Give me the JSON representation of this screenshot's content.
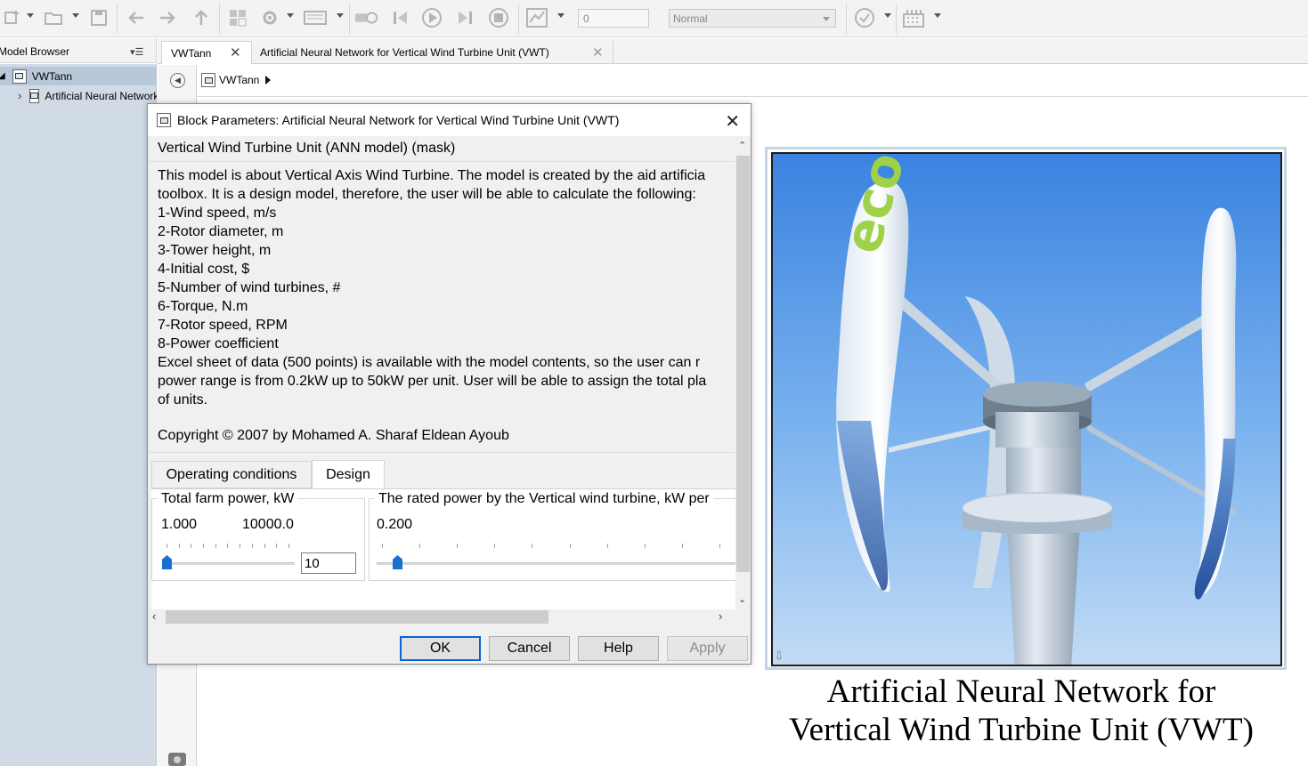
{
  "toolbar": {
    "stop_time_value": "0",
    "sim_mode": "Normal",
    "icons": [
      "new-model-icon",
      "open-icon",
      "save-icon",
      "back-icon",
      "forward-icon",
      "up-icon",
      "library-icon",
      "settings-icon",
      "explorer-icon",
      "record-icon",
      "step-back-icon",
      "run-icon",
      "step-forward-icon",
      "stop-icon",
      "scope-icon",
      "check-icon",
      "grid-icon"
    ]
  },
  "model_browser": {
    "title": "Model Browser",
    "menu_glyph": "▾☰",
    "items": [
      {
        "label": "VWTann"
      },
      {
        "label": "Artificial Neural Network for Vertical Wind Turbine Unit (VWT)"
      }
    ]
  },
  "tabs": [
    {
      "label": "VWTann",
      "close": "✕"
    },
    {
      "label": "Artificial Neural Network for  Vertical Wind Turbine Unit (VWT)",
      "close": "✕"
    }
  ],
  "breadcrumb": {
    "root": "VWTann"
  },
  "block": {
    "caption_line1": "Artificial Neural Network for",
    "caption_line2": "Vertical Wind Turbine Unit (VWT)",
    "image_text": "eco"
  },
  "dialog": {
    "title": "Block Parameters: Artificial Neural Network for  Vertical Wind Turbine Unit (VWT)",
    "mask_type": "Vertical Wind Turbine Unit (ANN model) (mask)",
    "description_lines": [
      "This model is about Vertical Axis Wind Turbine. The model is created by the aid artificia",
      "toolbox. It is a design model, therefore, the user will be able to calculate the following:",
      "1-Wind speed, m/s",
      "2-Rotor diameter, m",
      "3-Tower height, m",
      "4-Initial cost, $",
      "5-Number of wind turbines, #",
      "6-Torque, N.m",
      "7-Rotor speed, RPM",
      "8-Power coefficient",
      "Excel sheet of data (500 points) is available with the model contents, so the user can r",
      "power range is from 0.2kW up to 50kW per unit. User will be able to assign the total pla",
      "of units."
    ],
    "copyright": "Copyright © 2007 by Mohamed A. Sharaf Eldean Ayoub",
    "param_tabs": [
      {
        "label": "Operating conditions",
        "active": false
      },
      {
        "label": "Design",
        "active": true
      }
    ],
    "design": {
      "farm_power": {
        "label": "Total farm power, kW",
        "min": "1.000",
        "max": "10000.0",
        "value": "10",
        "slider_fraction": 0.0
      },
      "rated_power": {
        "label": "The rated power by the Vertical wind turbine, kW per",
        "min": "0.200",
        "slider_fraction": 0.04
      }
    },
    "buttons": {
      "ok": "OK",
      "cancel": "Cancel",
      "help": "Help",
      "apply": "Apply"
    }
  }
}
